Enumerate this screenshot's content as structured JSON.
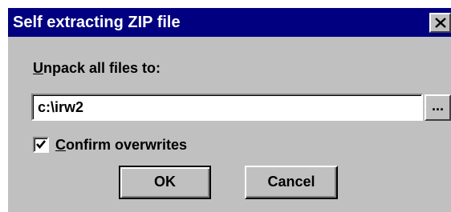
{
  "window": {
    "title": "Self extracting ZIP file",
    "close_symbol": "×"
  },
  "unpack": {
    "label_mnemonic": "U",
    "label_rest": "npack all files to:",
    "path_value": "c:\\irw2",
    "browse_label": "..."
  },
  "confirm": {
    "label_mnemonic": "C",
    "label_rest": "onfirm overwrites",
    "checked": true
  },
  "buttons": {
    "ok_label": "OK",
    "cancel_label": "Cancel"
  },
  "icons": {
    "close": "close-icon",
    "check": "checkmark-icon"
  },
  "colors": {
    "titlebar": "#000080",
    "face": "#c0c0c0"
  }
}
